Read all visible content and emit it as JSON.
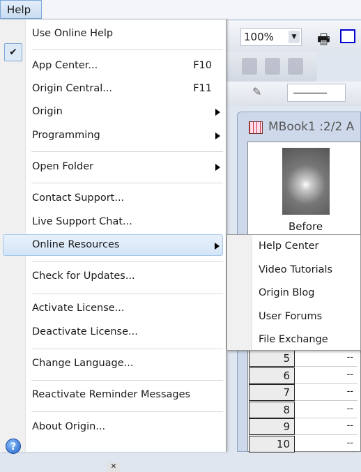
{
  "menubar": {
    "help": "Help"
  },
  "toolbar": {
    "zoom": "100%"
  },
  "worksheet": {
    "title": "MBook1 :2/2 A",
    "image_label": "Before",
    "rows": [
      {
        "n": "5",
        "v": "--"
      },
      {
        "n": "6",
        "v": "--"
      },
      {
        "n": "7",
        "v": "--"
      },
      {
        "n": "8",
        "v": "--"
      },
      {
        "n": "9",
        "v": "--"
      },
      {
        "n": "10",
        "v": "--"
      }
    ]
  },
  "menu": {
    "items": [
      {
        "label": "Use Online Help",
        "checked": true
      },
      {
        "label": "App Center...",
        "shortcut": "F10"
      },
      {
        "label": "Origin Central...",
        "shortcut": "F11"
      },
      {
        "label": "Origin",
        "submenu": true
      },
      {
        "label": "Programming",
        "submenu": true
      },
      {
        "label": "Open Folder",
        "submenu": true
      },
      {
        "label": "Contact Support..."
      },
      {
        "label": "Live Support Chat..."
      },
      {
        "label": "Online Resources",
        "submenu": true,
        "highlighted": true
      },
      {
        "label": "Check for Updates..."
      },
      {
        "label": "Activate License..."
      },
      {
        "label": "Deactivate License..."
      },
      {
        "label": "Change Language..."
      },
      {
        "label": "Reactivate Reminder Messages"
      },
      {
        "label": "About Origin...",
        "icon": "help-circle-icon"
      }
    ]
  },
  "submenu": {
    "items": [
      "Help Center",
      "Video Tutorials",
      "Origin Blog",
      "User Forums",
      "File Exchange"
    ]
  },
  "colors": {
    "highlight": "#d3e5f8",
    "highlight_border": "#a8c8ea"
  }
}
